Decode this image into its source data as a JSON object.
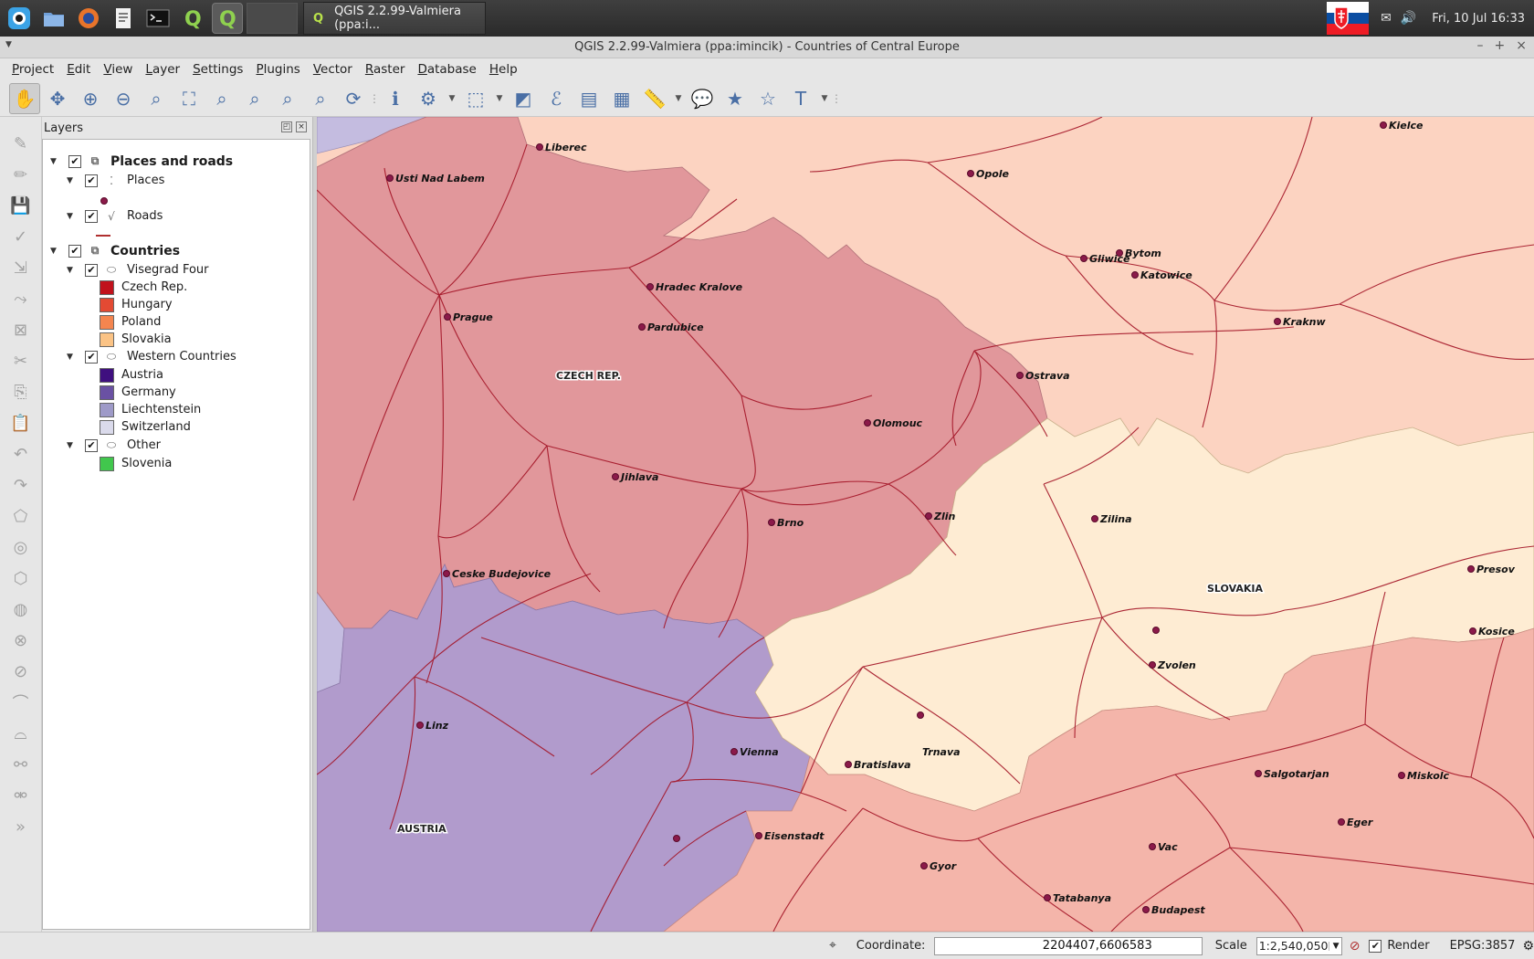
{
  "panel": {
    "task_title": "QGIS 2.2.99-Valmiera (ppa:i...",
    "clock": "Fri, 10 Jul  16:33",
    "launchers": [
      "system-menu-icon",
      "file-manager-icon",
      "firefox-icon",
      "text-editor-icon",
      "terminal-icon",
      "qgis-icon",
      "qgis-active-icon"
    ]
  },
  "window": {
    "title": "QGIS 2.2.99-Valmiera (ppa:imincik) - Countries of Central Europe"
  },
  "menu": [
    "Project",
    "Edit",
    "View",
    "Layer",
    "Settings",
    "Plugins",
    "Vector",
    "Raster",
    "Database",
    "Help"
  ],
  "layers_panel": {
    "title": "Layers",
    "groups": [
      {
        "name": "Places and roads",
        "layers": [
          {
            "name": "Places",
            "symbol": "point"
          },
          {
            "name": "Roads",
            "symbol": "line"
          }
        ]
      },
      {
        "name": "Countries",
        "subgroups": [
          {
            "name": "Visegrad Four",
            "classes": [
              {
                "name": "Czech Rep.",
                "color": "#c1121c"
              },
              {
                "name": "Hungary",
                "color": "#e34a33"
              },
              {
                "name": "Poland",
                "color": "#f4854f"
              },
              {
                "name": "Slovakia",
                "color": "#fbc385"
              }
            ]
          },
          {
            "name": "Western Countries",
            "classes": [
              {
                "name": "Austria",
                "color": "#3f0f7f"
              },
              {
                "name": "Germany",
                "color": "#6a51a3"
              },
              {
                "name": "Liechtenstein",
                "color": "#9e9ac8"
              },
              {
                "name": "Switzerland",
                "color": "#dadaeb"
              }
            ]
          },
          {
            "name": "Other",
            "classes": [
              {
                "name": "Slovenia",
                "color": "#41c74d"
              }
            ]
          }
        ]
      }
    ]
  },
  "map": {
    "country_colors": {
      "czech": "#e1979b",
      "austria": "#b19bcc",
      "germany": "#c4bce0",
      "poland": "#fdd0bd",
      "slovakia": "#feecd3",
      "hungary": "#f4b5aa",
      "road": "#a31325",
      "city": "#8b1a4a"
    },
    "country_labels": [
      "CZECH REP.",
      "SLOVAKIA",
      "AUSTRIA"
    ],
    "cities": [
      "Liberec",
      "Usti Nad Labem",
      "Opole",
      "Kielce",
      "Gliwice",
      "Bytom",
      "Katowice",
      "Hradec Kralove",
      "Kraknw",
      "Prague",
      "Pardubice",
      "Ostrava",
      "Olomouc",
      "Jihlava",
      "Zlin",
      "Brno",
      "Zilina",
      "Presov",
      "Ceske Budejovice",
      "Kosice",
      "Zvolen",
      "Linz",
      "Trnava",
      "Vienna",
      "Bratislava",
      "Salgotarjan",
      "Miskolc",
      "Eger",
      "Eisenstadt",
      "Vac",
      "Gyor",
      "Tatabanya",
      "Budapest"
    ]
  },
  "status": {
    "coordinate_label": "Coordinate:",
    "coordinate_value": "2204407,6606583",
    "scale_label": "Scale",
    "scale_value": "1:2,540,050",
    "render_label": "Render",
    "crs": "EPSG:3857"
  }
}
